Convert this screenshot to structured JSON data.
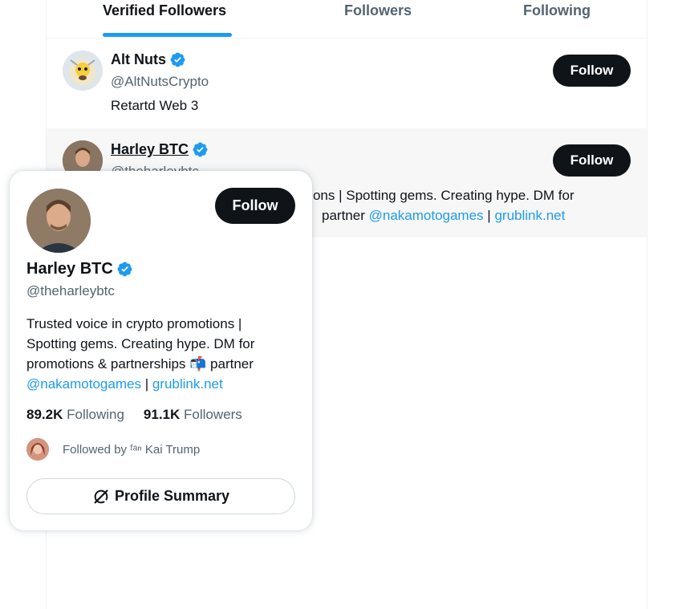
{
  "tabs": [
    {
      "label": "Verified Followers",
      "active": true
    },
    {
      "label": "Followers",
      "active": false
    },
    {
      "label": "Following",
      "active": false
    }
  ],
  "list": [
    {
      "name": "Alt Nuts",
      "handle": "@AltNutsCrypto",
      "bio": "Retartd Web 3",
      "follow_label": "Follow"
    },
    {
      "name": "Harley BTC",
      "handle": "@theharleybtc",
      "bio_line1": "otions | Spotting gems. Creating hype. DM for",
      "bio_line2_text": "partner",
      "bio_mention": "@nakamotogames",
      "bio_sep": "|",
      "bio_link": "grublink.net",
      "follow_label": "Follow"
    }
  ],
  "hover_card": {
    "name": "Harley BTC",
    "handle": "@theharleybtc",
    "follow_label": "Follow",
    "bio_line1": "Trusted voice in crypto promotions |",
    "bio_line2": "Spotting gems. Creating hype. DM for",
    "bio_line3": "promotions & partnerships 📬 partner",
    "bio_mention": "@nakamotogames",
    "bio_sep": "|",
    "bio_link": "grublink.net",
    "following_count": "89.2K",
    "following_label": "Following",
    "followers_count": "91.1K",
    "followers_label": "Followers",
    "followed_by": "Followed by ᶠᵃⁿ Kai Trump",
    "summary_label": "Profile Summary"
  },
  "colors": {
    "accent": "#1d9bf0",
    "text": "#0f1419",
    "muted": "#536471",
    "button": "#0f1419"
  }
}
